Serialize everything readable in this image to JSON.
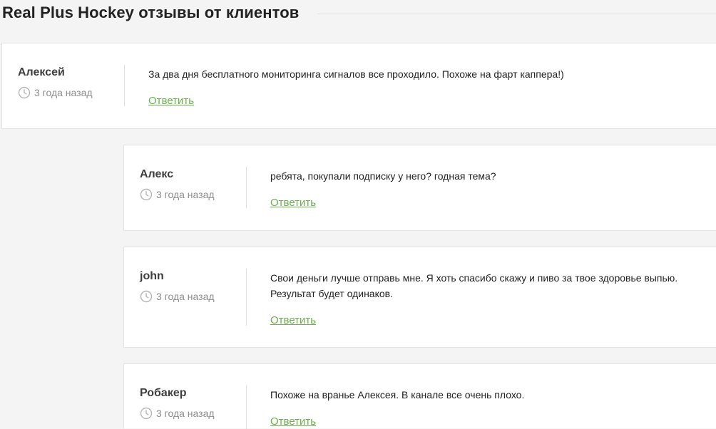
{
  "header": {
    "title": "Real Plus Hockey отзывы от клиентов"
  },
  "colors": {
    "background": "#f4f4f4",
    "card": "#ffffff",
    "border": "#e3e3e3",
    "reply_link": "#6ab04c",
    "date_text": "#8d8d8d"
  },
  "comments": [
    {
      "author": "Алексей",
      "date": "3 года назад",
      "text_lines": [
        "За два дня бесплатного мониторинга сигналов все проходило. Похоже на фарт каппера!)"
      ],
      "reply_label": "Ответить",
      "date_icon": "clock-icon"
    },
    {
      "author": "Алекс",
      "date": "3 года назад",
      "text_lines": [
        "ребята, покупали подписку у него? годная тема?"
      ],
      "reply_label": "Ответить",
      "date_icon": "clock-icon"
    },
    {
      "author": "john",
      "date": "3 года назад",
      "text_lines": [
        "Свои деньги лучше отправь мне. Я хоть спасибо скажу и пиво за твое здоровье выпью.",
        "Результат будет одинаков."
      ],
      "reply_label": "Ответить",
      "date_icon": "clock-icon"
    },
    {
      "author": "Робакер",
      "date": "3 года назад",
      "text_lines": [
        "Похоже на вранье Алексея. В канале все очень плохо."
      ],
      "reply_label": "Ответить",
      "date_icon": "clock-icon"
    }
  ]
}
